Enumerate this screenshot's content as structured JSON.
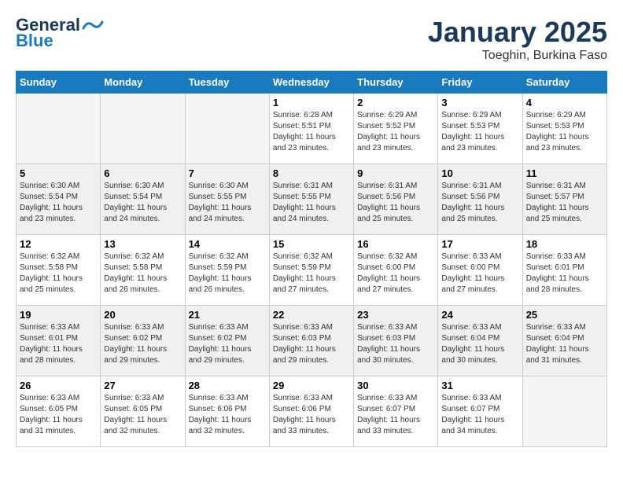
{
  "header": {
    "logo_line1": "General",
    "logo_line2": "Blue",
    "title": "January 2025",
    "subtitle": "Toeghin, Burkina Faso"
  },
  "weekdays": [
    "Sunday",
    "Monday",
    "Tuesday",
    "Wednesday",
    "Thursday",
    "Friday",
    "Saturday"
  ],
  "weeks": [
    [
      {
        "day": "",
        "info": "",
        "empty": true
      },
      {
        "day": "",
        "info": "",
        "empty": true
      },
      {
        "day": "",
        "info": "",
        "empty": true
      },
      {
        "day": "1",
        "info": "Sunrise: 6:28 AM\nSunset: 5:51 PM\nDaylight: 11 hours\nand 23 minutes."
      },
      {
        "day": "2",
        "info": "Sunrise: 6:29 AM\nSunset: 5:52 PM\nDaylight: 11 hours\nand 23 minutes."
      },
      {
        "day": "3",
        "info": "Sunrise: 6:29 AM\nSunset: 5:53 PM\nDaylight: 11 hours\nand 23 minutes."
      },
      {
        "day": "4",
        "info": "Sunrise: 6:29 AM\nSunset: 5:53 PM\nDaylight: 11 hours\nand 23 minutes."
      }
    ],
    [
      {
        "day": "5",
        "info": "Sunrise: 6:30 AM\nSunset: 5:54 PM\nDaylight: 11 hours\nand 23 minutes."
      },
      {
        "day": "6",
        "info": "Sunrise: 6:30 AM\nSunset: 5:54 PM\nDaylight: 11 hours\nand 24 minutes."
      },
      {
        "day": "7",
        "info": "Sunrise: 6:30 AM\nSunset: 5:55 PM\nDaylight: 11 hours\nand 24 minutes."
      },
      {
        "day": "8",
        "info": "Sunrise: 6:31 AM\nSunset: 5:55 PM\nDaylight: 11 hours\nand 24 minutes."
      },
      {
        "day": "9",
        "info": "Sunrise: 6:31 AM\nSunset: 5:56 PM\nDaylight: 11 hours\nand 25 minutes."
      },
      {
        "day": "10",
        "info": "Sunrise: 6:31 AM\nSunset: 5:56 PM\nDaylight: 11 hours\nand 25 minutes."
      },
      {
        "day": "11",
        "info": "Sunrise: 6:31 AM\nSunset: 5:57 PM\nDaylight: 11 hours\nand 25 minutes."
      }
    ],
    [
      {
        "day": "12",
        "info": "Sunrise: 6:32 AM\nSunset: 5:58 PM\nDaylight: 11 hours\nand 25 minutes."
      },
      {
        "day": "13",
        "info": "Sunrise: 6:32 AM\nSunset: 5:58 PM\nDaylight: 11 hours\nand 26 minutes."
      },
      {
        "day": "14",
        "info": "Sunrise: 6:32 AM\nSunset: 5:59 PM\nDaylight: 11 hours\nand 26 minutes."
      },
      {
        "day": "15",
        "info": "Sunrise: 6:32 AM\nSunset: 5:59 PM\nDaylight: 11 hours\nand 27 minutes."
      },
      {
        "day": "16",
        "info": "Sunrise: 6:32 AM\nSunset: 6:00 PM\nDaylight: 11 hours\nand 27 minutes."
      },
      {
        "day": "17",
        "info": "Sunrise: 6:33 AM\nSunset: 6:00 PM\nDaylight: 11 hours\nand 27 minutes."
      },
      {
        "day": "18",
        "info": "Sunrise: 6:33 AM\nSunset: 6:01 PM\nDaylight: 11 hours\nand 28 minutes."
      }
    ],
    [
      {
        "day": "19",
        "info": "Sunrise: 6:33 AM\nSunset: 6:01 PM\nDaylight: 11 hours\nand 28 minutes."
      },
      {
        "day": "20",
        "info": "Sunrise: 6:33 AM\nSunset: 6:02 PM\nDaylight: 11 hours\nand 29 minutes."
      },
      {
        "day": "21",
        "info": "Sunrise: 6:33 AM\nSunset: 6:02 PM\nDaylight: 11 hours\nand 29 minutes."
      },
      {
        "day": "22",
        "info": "Sunrise: 6:33 AM\nSunset: 6:03 PM\nDaylight: 11 hours\nand 29 minutes."
      },
      {
        "day": "23",
        "info": "Sunrise: 6:33 AM\nSunset: 6:03 PM\nDaylight: 11 hours\nand 30 minutes."
      },
      {
        "day": "24",
        "info": "Sunrise: 6:33 AM\nSunset: 6:04 PM\nDaylight: 11 hours\nand 30 minutes."
      },
      {
        "day": "25",
        "info": "Sunrise: 6:33 AM\nSunset: 6:04 PM\nDaylight: 11 hours\nand 31 minutes."
      }
    ],
    [
      {
        "day": "26",
        "info": "Sunrise: 6:33 AM\nSunset: 6:05 PM\nDaylight: 11 hours\nand 31 minutes."
      },
      {
        "day": "27",
        "info": "Sunrise: 6:33 AM\nSunset: 6:05 PM\nDaylight: 11 hours\nand 32 minutes."
      },
      {
        "day": "28",
        "info": "Sunrise: 6:33 AM\nSunset: 6:06 PM\nDaylight: 11 hours\nand 32 minutes."
      },
      {
        "day": "29",
        "info": "Sunrise: 6:33 AM\nSunset: 6:06 PM\nDaylight: 11 hours\nand 33 minutes."
      },
      {
        "day": "30",
        "info": "Sunrise: 6:33 AM\nSunset: 6:07 PM\nDaylight: 11 hours\nand 33 minutes."
      },
      {
        "day": "31",
        "info": "Sunrise: 6:33 AM\nSunset: 6:07 PM\nDaylight: 11 hours\nand 34 minutes."
      },
      {
        "day": "",
        "info": "",
        "empty": true
      }
    ]
  ]
}
